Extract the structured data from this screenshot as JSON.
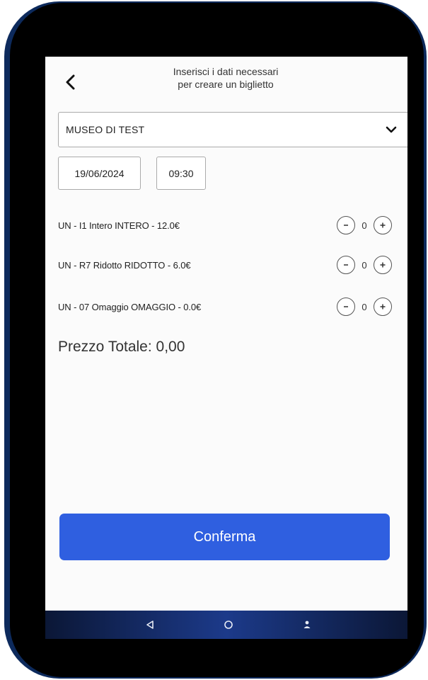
{
  "header": {
    "line1": "Inserisci i dati necessari",
    "line2": "per creare un biglietto"
  },
  "museum_select": {
    "selected": "MUSEO DI TEST"
  },
  "date_field": {
    "value": "19/06/2024"
  },
  "time_field": {
    "value": "09:30"
  },
  "tickets": [
    {
      "label": "UN - I1 Intero INTERO - 12.0€",
      "quantity": "0",
      "minus": "-",
      "plus": "+"
    },
    {
      "label": "UN - R7 Ridotto RIDOTTO - 6.0€",
      "quantity": "0",
      "minus": "-",
      "plus": "+"
    },
    {
      "label": "UN - 07 Omaggio OMAGGIO - 0.0€",
      "quantity": "0",
      "minus": "-",
      "plus": "+"
    }
  ],
  "total": {
    "text": "Prezzo Totale: 0,00"
  },
  "confirm_button": {
    "label": "Conferma"
  },
  "colors": {
    "accent": "#2f5fe0",
    "bezel": "#000000",
    "nav_bar": "#1c3a8a"
  },
  "icons": {
    "back": "back-arrow-icon",
    "dropdown": "chevron-down-icon",
    "nav_back": "nav-back-triangle-icon",
    "nav_home": "nav-home-circle-icon",
    "nav_user": "nav-user-icon"
  }
}
